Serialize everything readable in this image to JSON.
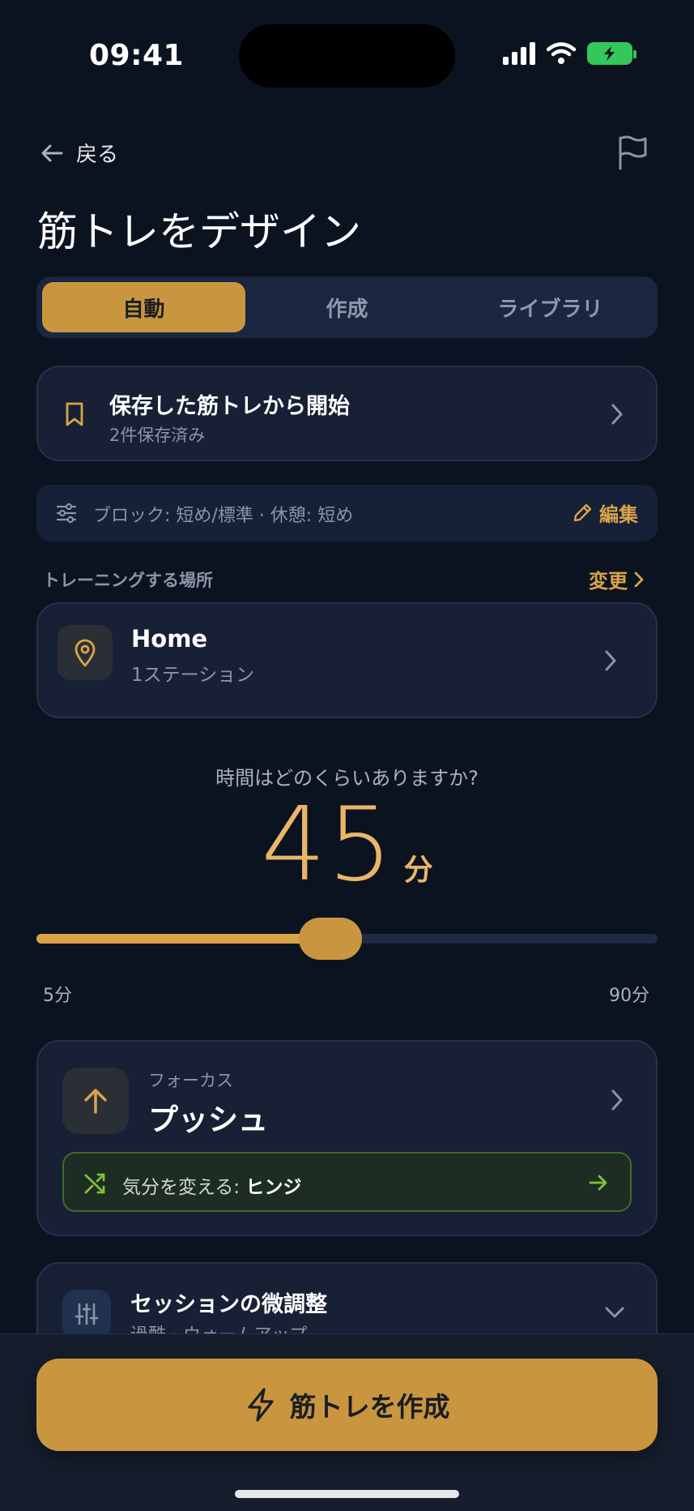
{
  "status_bar": {
    "time": "09:41"
  },
  "header": {
    "back_label": "戻る",
    "title": "筋トレをデザイン"
  },
  "tabs": [
    {
      "label": "自動",
      "active": true
    },
    {
      "label": "作成",
      "active": false
    },
    {
      "label": "ライブラリ",
      "active": false
    }
  ],
  "saved": {
    "title": "保存した筋トレから開始",
    "subtitle": "2件保存済み"
  },
  "block_settings": {
    "text": "ブロック: 短め/標準 · 休憩: 短め",
    "edit_label": "編集"
  },
  "location": {
    "section_label": "トレーニングする場所",
    "change_label": "変更",
    "name": "Home",
    "stations": "1ステーション"
  },
  "duration": {
    "question": "時間はどのくらいありますか?",
    "value": "45",
    "unit": "分",
    "min_label": "5分",
    "max_label": "90分",
    "min": 5,
    "max": 90,
    "current": 45
  },
  "focus": {
    "label": "フォーカス",
    "value": "プッシュ",
    "swap_prefix": "気分を変える: ",
    "swap_target": "ヒンジ"
  },
  "tune": {
    "title": "セッションの微調整",
    "subtitle": "過酷 · ウォームアップ"
  },
  "cta": {
    "label": "筋トレを作成"
  },
  "colors": {
    "accent": "#c9963f",
    "background": "#0c1320",
    "card": "#172034",
    "swap_border": "#3f6b2a"
  },
  "icons": [
    "back-arrow-icon",
    "flag-icon",
    "bookmark-icon",
    "chevron-right-icon",
    "sliders-icon",
    "pencil-icon",
    "location-pin-icon",
    "arrow-up-icon",
    "shuffle-icon",
    "arrow-right-icon",
    "chevron-down-icon",
    "lightning-icon"
  ]
}
